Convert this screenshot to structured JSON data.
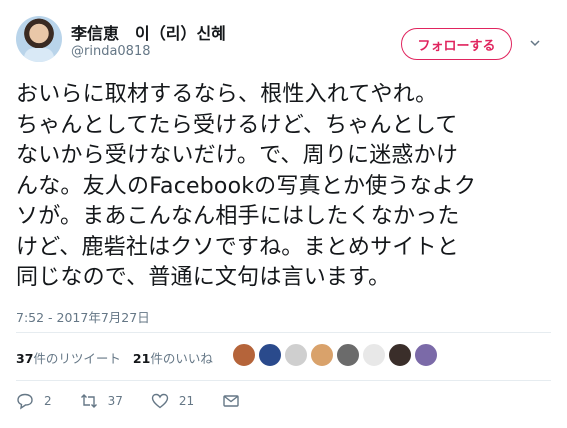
{
  "user": {
    "display_name": "李信恵　이（리）신혜",
    "handle": "@rinda0818"
  },
  "follow_label": "フォローする",
  "tweet_lines": [
    "おいらに取材するなら、根性入れてやれ。",
    "ちゃんとしてたら受けるけど、ちゃんとして",
    "ないから受けないだけ。で、周りに迷惑かけ",
    "んな。友人のFacebookの写真とか使うなよク",
    "ソが。まあこんなん相手にはしたくなかった",
    "けど、鹿砦社はクソですね。まとめサイトと",
    "同じなので、普通に文句は言います。"
  ],
  "timestamp": "7:52 - 2017年7月27日",
  "stats": {
    "retweet_count": "37",
    "retweet_label": "件のリツイート",
    "like_count": "21",
    "like_label": "件のいいね"
  },
  "actions": {
    "reply_count": "2",
    "retweet_count": "37",
    "like_count": "21"
  },
  "colors": {
    "accent": "#e0245e",
    "muted": "#657786",
    "text": "#14171a",
    "divider": "#e6ecf0"
  },
  "liker_colors": [
    "#b5643a",
    "#2a4a8c",
    "#cfcfcf",
    "#d9a26b",
    "#6b6b6b",
    "#e8e8e8",
    "#3a2e2a",
    "#7b6aa8",
    "#ffffff"
  ]
}
